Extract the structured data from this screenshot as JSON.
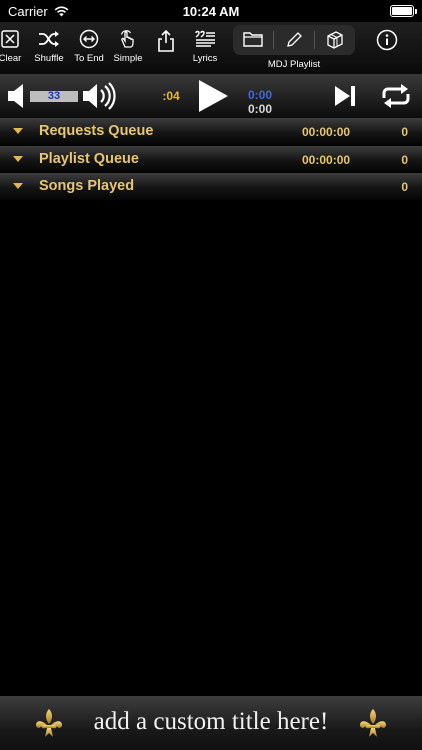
{
  "status_bar": {
    "carrier": "Carrier",
    "time": "10:24 AM"
  },
  "toolbar": {
    "clear_label": "Clear",
    "shuffle_label": "Shuffle",
    "to_end_label": "To End",
    "simple_label": "Simple",
    "lyrics_label": "Lyrics",
    "mdj_playlist_label": "MDJ Playlist"
  },
  "player": {
    "volume": "33",
    "elapsed": ":04",
    "time_top": "0:00",
    "time_bottom": "0:00"
  },
  "queues": [
    {
      "name": "Requests Queue",
      "duration": "00:00:00",
      "count": "0"
    },
    {
      "name": "Playlist Queue",
      "duration": "00:00:00",
      "count": "0"
    },
    {
      "name": "Songs Played",
      "duration": "",
      "count": "0"
    }
  ],
  "footer": {
    "title": "add a custom title here!"
  },
  "colors": {
    "accent_gold": "#e6c671",
    "time_blue": "#3e66e6",
    "volume_blue": "#1c35b0"
  }
}
